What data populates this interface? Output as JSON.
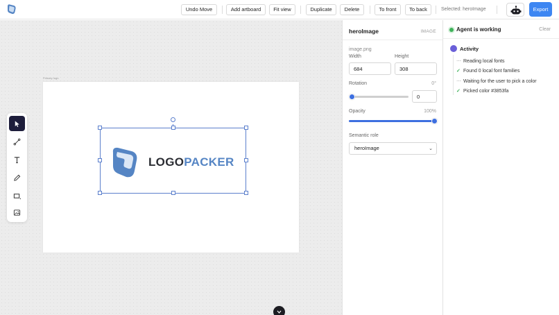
{
  "app": {
    "logo_icon": "app-logo-icon",
    "accent_color": "#3d86f2"
  },
  "toolbar": {
    "undo_label": "Undo Move",
    "add_artboard_label": "Add artboard",
    "fit_view_label": "Fit view",
    "duplicate_label": "Duplicate",
    "delete_label": "Delete",
    "to_front_label": "To front",
    "to_back_label": "To back",
    "selected_label": "Selected: heroImage",
    "agent_icon": "robot-icon",
    "export_label": "Export"
  },
  "canvas": {
    "artboard_name": "Primary logo",
    "logo_text_part1": "LOGO",
    "logo_text_part2": "PACKER",
    "tools": [
      {
        "name": "select-tool",
        "icon": "cursor-arrow-icon",
        "active": true
      },
      {
        "name": "path-tool",
        "icon": "path-icon",
        "active": false
      },
      {
        "name": "text-tool",
        "icon": "text-icon",
        "active": false
      },
      {
        "name": "pen-tool",
        "icon": "pen-icon",
        "active": false
      },
      {
        "name": "rectangle-tool",
        "icon": "rectangle-icon",
        "active": false
      },
      {
        "name": "image-tool",
        "icon": "image-icon",
        "active": false
      }
    ],
    "bottom_icon": "chevron-down-icon"
  },
  "properties": {
    "name": "heroImage",
    "kind": "IMAGE",
    "file": "image.png",
    "width_label": "Width",
    "width_value": "684",
    "height_label": "Height",
    "height_value": "308",
    "rotation_label": "Rotation",
    "rotation_display": "0°",
    "rotation_value": "0",
    "rotation_fraction": 0,
    "opacity_label": "Opacity",
    "opacity_display": "100%",
    "opacity_fraction": 1,
    "role_label": "Semantic role",
    "role_value": "heroImage"
  },
  "agent": {
    "status": "Agent is working",
    "clear_label": "Clear",
    "activity_title": "Activity",
    "items": [
      {
        "text": "Reading local fonts",
        "state": "pending"
      },
      {
        "text": "Found 0 local font families",
        "state": "done"
      },
      {
        "text": "Waiting for the user to pick a color",
        "state": "pending"
      },
      {
        "text": "Picked color #3853fa",
        "state": "done"
      }
    ]
  }
}
